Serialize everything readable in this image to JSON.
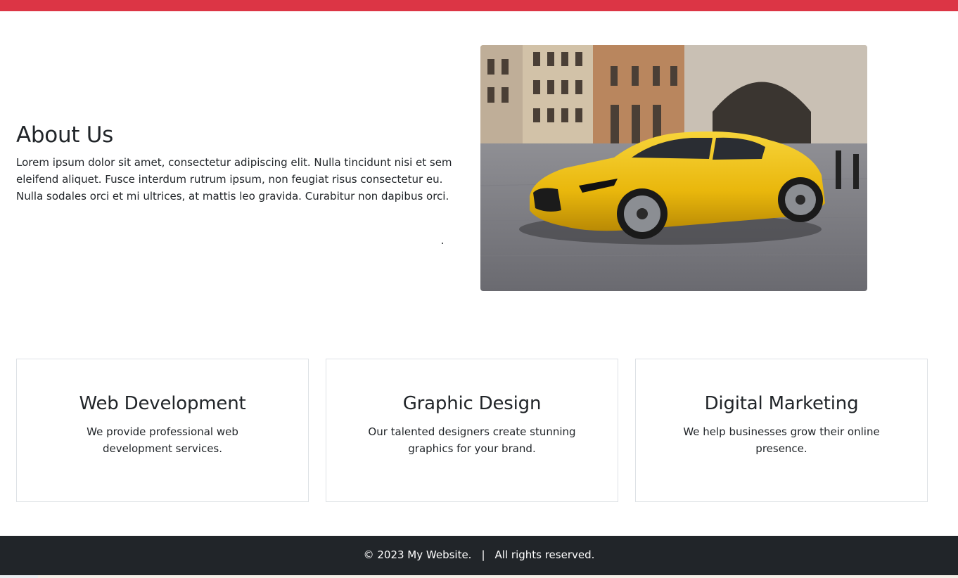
{
  "about": {
    "title": "About Us",
    "text": "Lorem ipsum dolor sit amet, consectetur adipiscing elit. Nulla tincidunt nisi et sem eleifend aliquet. Fusce interdum rutrum ipsum, non feugiat risus consectetur eu. Nulla sodales orci et mi ultrices, at mattis leo gravida. Curabitur non dapibus orci."
  },
  "services": [
    {
      "title": "Web Development",
      "text": "We provide professional web development services."
    },
    {
      "title": "Graphic Design",
      "text": "Our talented designers create stunning graphics for your brand."
    },
    {
      "title": "Digital Marketing",
      "text": "We help businesses grow their online presence."
    }
  ],
  "footer": {
    "copyright": "© 2023 My Website.",
    "separator": "|",
    "rights": "All rights reserved."
  },
  "colors": {
    "accent_bar": "#dc3545",
    "footer_bg": "#212529",
    "card_border": "#dee2e6"
  }
}
